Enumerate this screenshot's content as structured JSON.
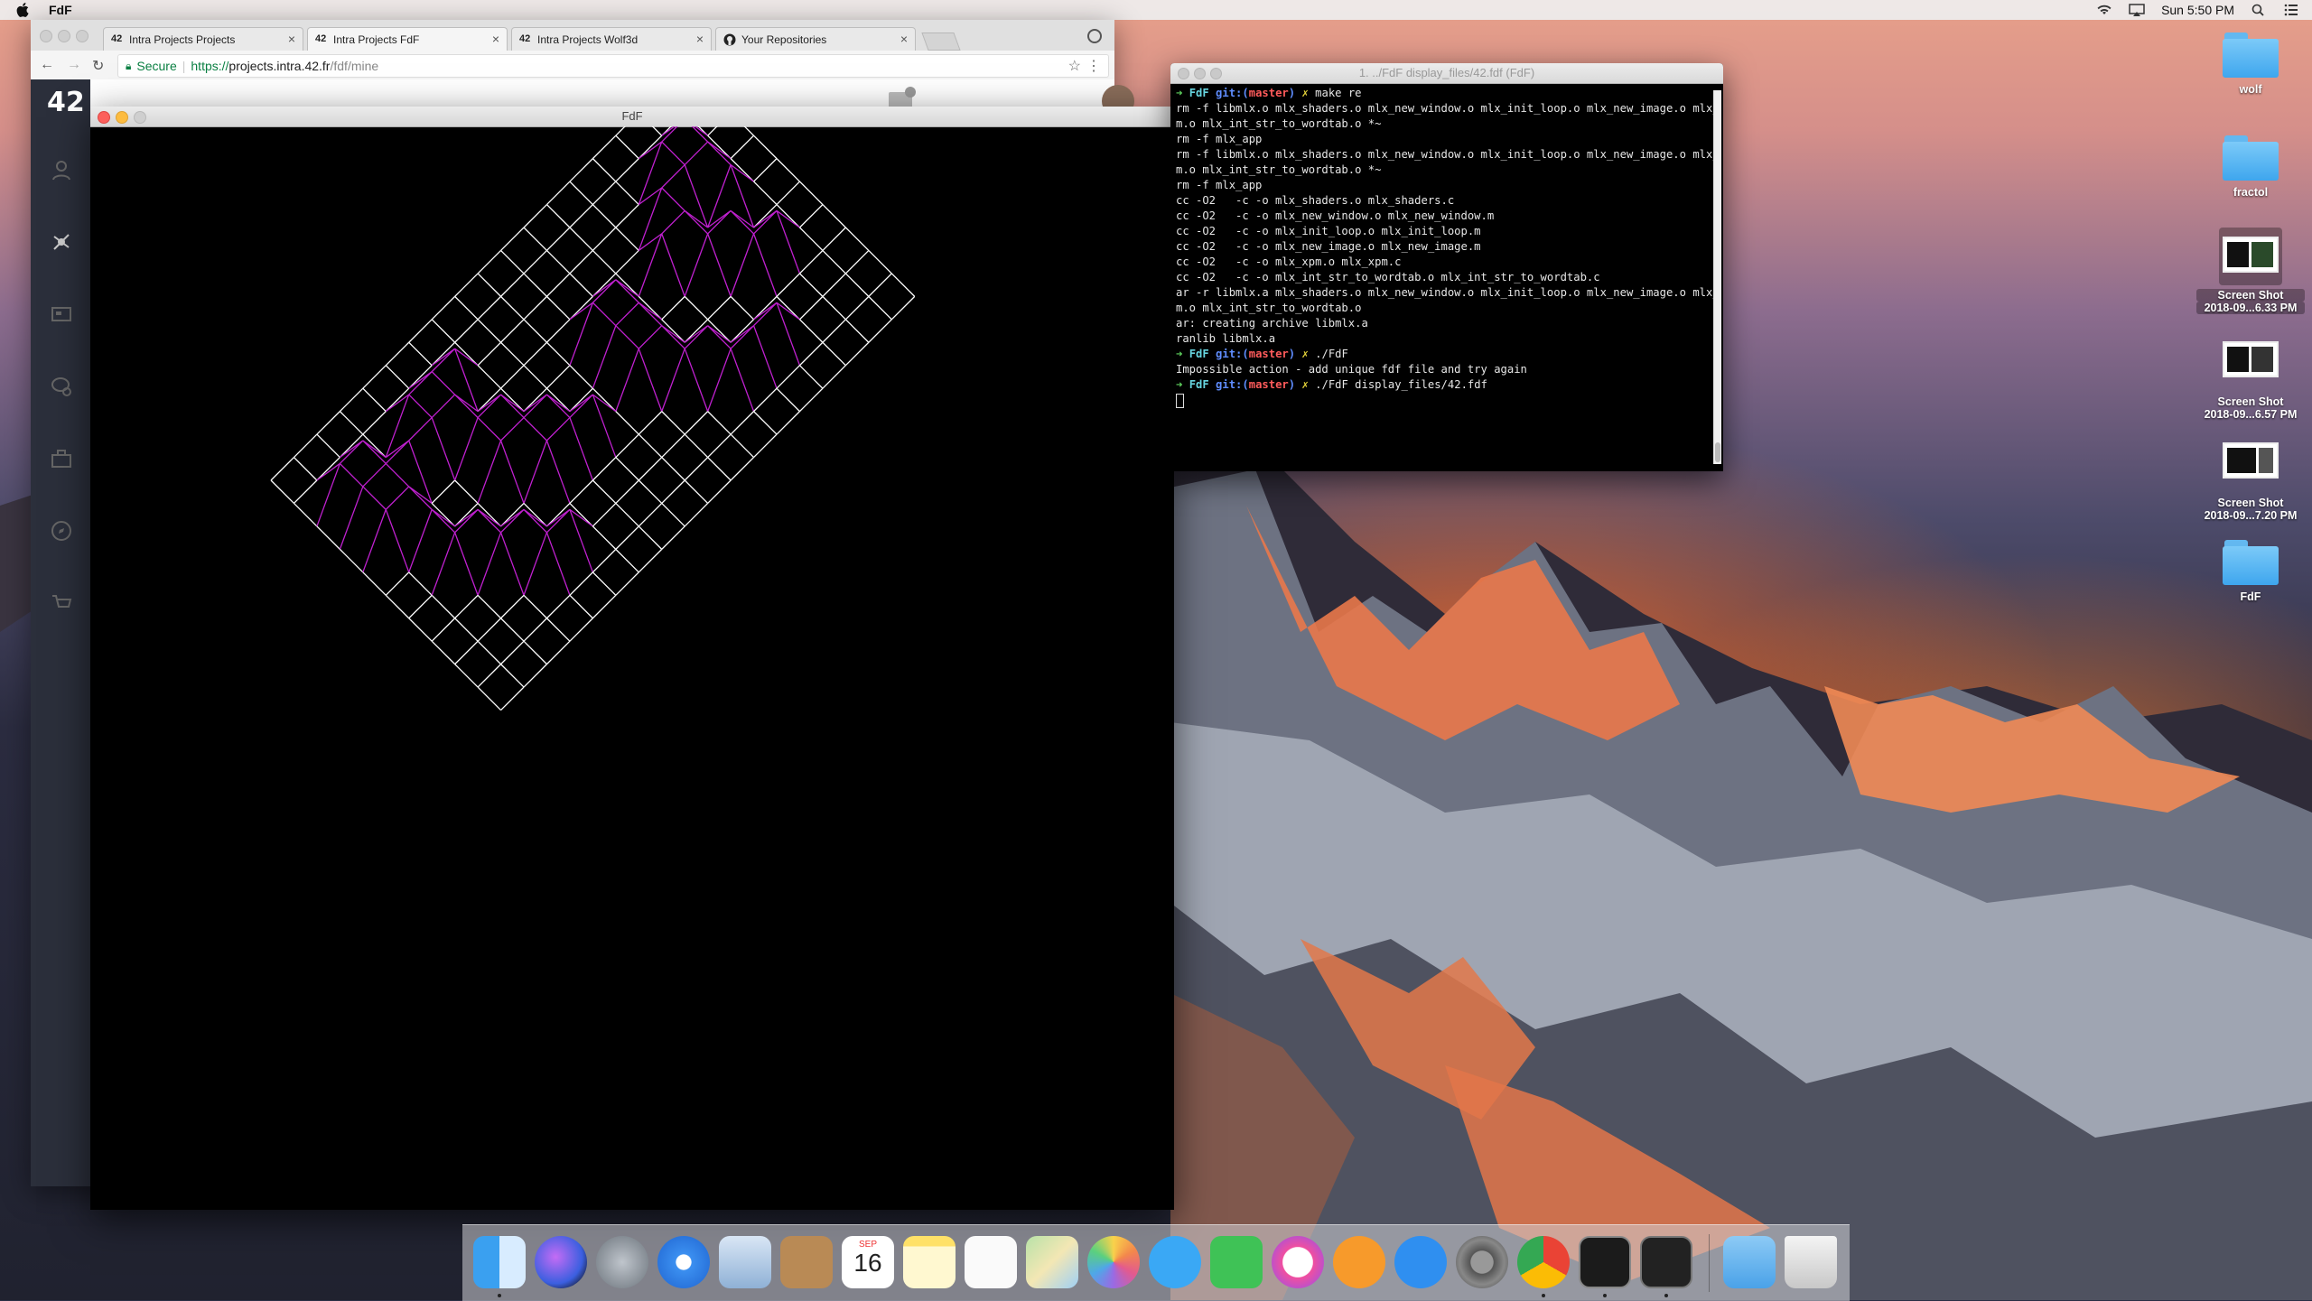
{
  "menubar": {
    "app_name": "FdF",
    "clock": "Sun 5:50 PM"
  },
  "browser": {
    "tabs": [
      {
        "label": "Intra Projects Projects",
        "favicon": "42"
      },
      {
        "label": "Intra Projects FdF",
        "favicon": "42"
      },
      {
        "label": "Intra Projects Wolf3d",
        "favicon": "42"
      },
      {
        "label": "Your Repositories",
        "favicon": "github-icon"
      }
    ],
    "active_tab": 1,
    "address": {
      "secure_label": "Secure",
      "scheme": "https://",
      "host": "projects.intra.42.fr",
      "path": "/fdf/mine"
    },
    "logo": "42"
  },
  "fdf_window": {
    "title": "FdF",
    "grid_color": "#ffffff",
    "relief_color": "#c020d0"
  },
  "terminal": {
    "title": "1. ../FdF display_files/42.fdf (FdF)",
    "prompt": {
      "dir": "FdF",
      "git": "git:(",
      "branch": "master",
      "close": ")",
      "dirty": "✗"
    },
    "lines": [
      {
        "kind": "prompt",
        "cmd": "make re"
      },
      {
        "kind": "out",
        "text": "rm -f libmlx.o mlx_shaders.o mlx_new_window.o mlx_init_loop.o mlx_new_image.o mlx_xp"
      },
      {
        "kind": "out",
        "text": "m.o mlx_int_str_to_wordtab.o *~"
      },
      {
        "kind": "out",
        "text": "rm -f mlx_app"
      },
      {
        "kind": "out",
        "text": "rm -f libmlx.o mlx_shaders.o mlx_new_window.o mlx_init_loop.o mlx_new_image.o mlx_xp"
      },
      {
        "kind": "out",
        "text": "m.o mlx_int_str_to_wordtab.o *~"
      },
      {
        "kind": "out",
        "text": "rm -f mlx_app"
      },
      {
        "kind": "out",
        "text": "cc -O2   -c -o mlx_shaders.o mlx_shaders.c"
      },
      {
        "kind": "out",
        "text": "cc -O2   -c -o mlx_new_window.o mlx_new_window.m"
      },
      {
        "kind": "out",
        "text": "cc -O2   -c -o mlx_init_loop.o mlx_init_loop.m"
      },
      {
        "kind": "out",
        "text": "cc -O2   -c -o mlx_new_image.o mlx_new_image.m"
      },
      {
        "kind": "out",
        "text": "cc -O2   -c -o mlx_xpm.o mlx_xpm.c"
      },
      {
        "kind": "out",
        "text": "cc -O2   -c -o mlx_int_str_to_wordtab.o mlx_int_str_to_wordtab.c"
      },
      {
        "kind": "out",
        "text": "ar -r libmlx.a mlx_shaders.o mlx_new_window.o mlx_init_loop.o mlx_new_image.o mlx_xp"
      },
      {
        "kind": "out",
        "text": "m.o mlx_int_str_to_wordtab.o"
      },
      {
        "kind": "out",
        "text": "ar: creating archive libmlx.a"
      },
      {
        "kind": "out",
        "text": "ranlib libmlx.a"
      },
      {
        "kind": "prompt",
        "cmd": "./FdF"
      },
      {
        "kind": "out",
        "text": "Impossible action - add unique fdf file and try again"
      },
      {
        "kind": "prompt",
        "cmd": "./FdF display_files/42.fdf"
      }
    ]
  },
  "desktop_icons": [
    {
      "label": "wolf",
      "type": "folder"
    },
    {
      "label": "fractol",
      "type": "folder"
    },
    {
      "label": "Screen Shot",
      "sub": "2018-09...6.33 PM",
      "type": "screenshot",
      "selected": true
    },
    {
      "label": "Screen Shot",
      "sub": "2018-09...6.57 PM",
      "type": "screenshot"
    },
    {
      "label": "Screen Shot",
      "sub": "2018-09...7.20 PM",
      "type": "screenshot"
    },
    {
      "label": "FdF",
      "type": "folder"
    }
  ],
  "dock": {
    "calendar_month": "SEP",
    "calendar_day": "16",
    "apps": [
      "finder-icon",
      "siri-icon",
      "launchpad-icon",
      "safari-icon",
      "mail-icon",
      "contacts-icon",
      "calendar-icon",
      "notes-icon",
      "reminders-icon",
      "maps-icon",
      "photos-icon",
      "messages-icon",
      "facetime-icon",
      "itunes-icon",
      "ibooks-icon",
      "app-store-icon",
      "system-preferences-icon",
      "chrome-icon",
      "terminal-icon",
      "terminal-exec-icon",
      "downloads-folder-icon",
      "trash-icon"
    ]
  }
}
